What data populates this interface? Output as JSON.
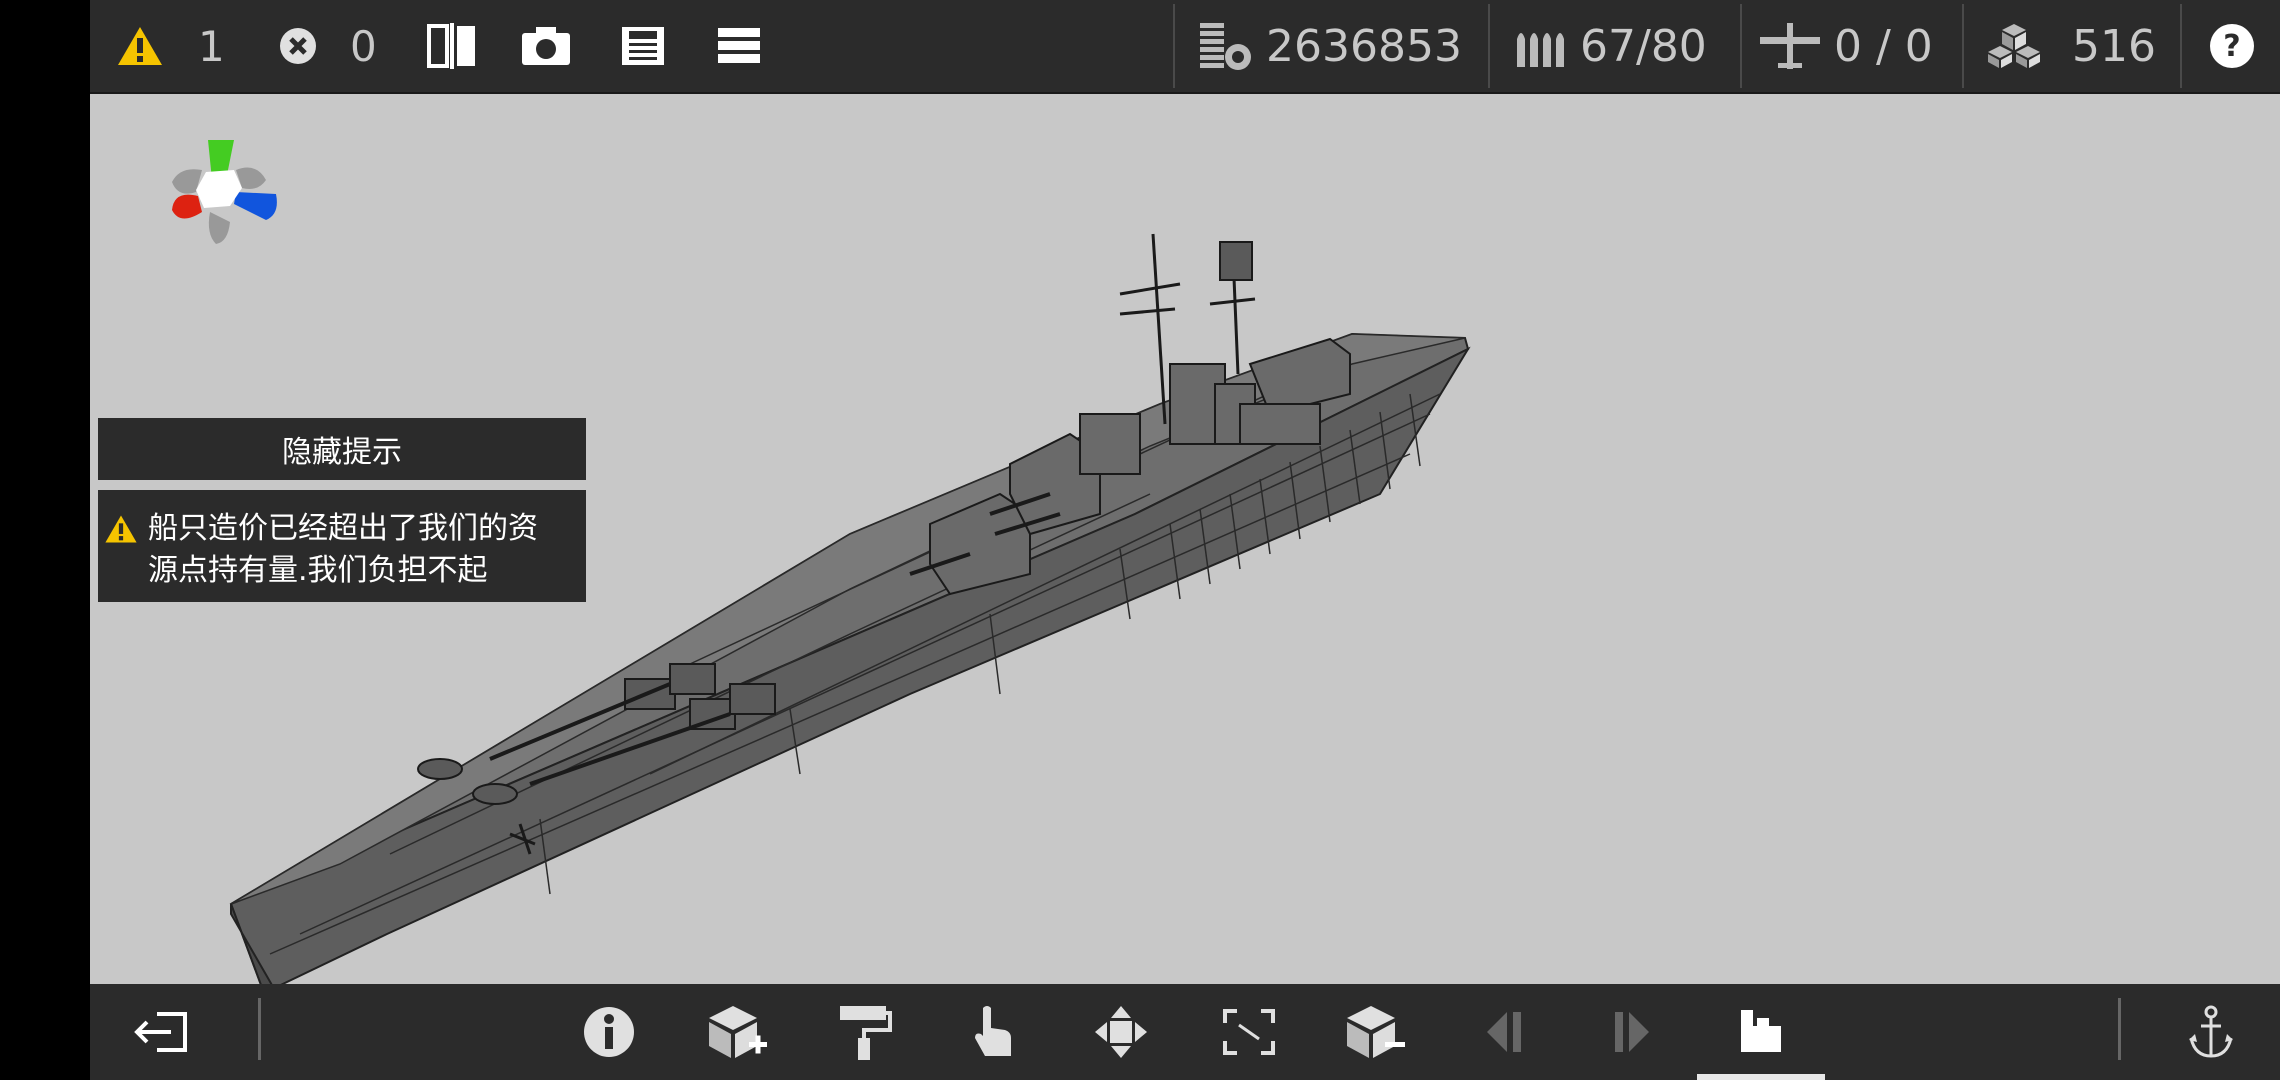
{
  "topbar": {
    "warning_count": "1",
    "error_count": "0",
    "cost": "2636853",
    "ammo": "67/80",
    "aircraft": "0 / 0",
    "blocks": "516",
    "help_label": "?"
  },
  "hint": {
    "hide_label": "隐藏提示",
    "warning_line1": "船只造价已经超出了我们的资",
    "warning_line2": "源点持有量.我们负担不起"
  },
  "colors": {
    "bar_bg": "#2b2b2b",
    "viewport_bg": "#c8c8c8",
    "warning_yellow": "#f5c400",
    "axis_green": "#44cc22",
    "axis_red": "#dd2211",
    "axis_blue": "#1155dd"
  },
  "icons": {
    "warning": "warning-icon",
    "error": "close-circle-icon",
    "mirror": "mirror-icon",
    "camera": "camera-icon",
    "save": "save-icon",
    "menu": "menu-icon",
    "cost": "cost-icon",
    "ammo": "ammo-icon",
    "aircraft": "aircraft-icon",
    "blocks": "blocks-icon",
    "help": "help-icon",
    "exit": "exit-icon",
    "info": "info-icon",
    "add_block": "add-block-icon",
    "paint": "paint-roller-icon",
    "select": "hand-pointer-icon",
    "move": "move-icon",
    "resize": "resize-icon",
    "remove_block": "remove-block-icon",
    "prev": "previous-icon",
    "next": "next-icon",
    "build_mode": "build-mode-icon",
    "anchor": "anchor-icon"
  }
}
